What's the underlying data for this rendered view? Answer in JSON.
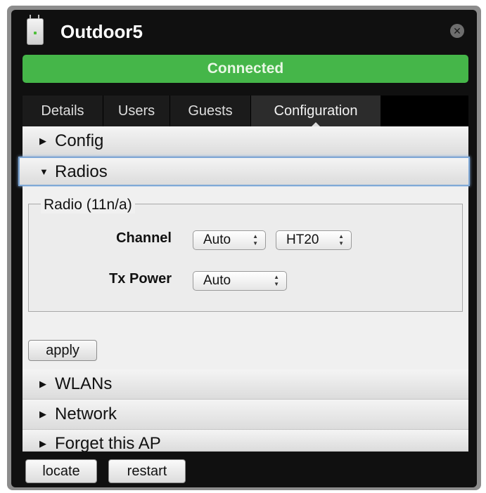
{
  "window": {
    "title": "Outdoor5",
    "close_icon": "close-icon",
    "device_icon": "access-point-icon"
  },
  "status": {
    "text": "Connected",
    "color": "#45b649"
  },
  "tabs": [
    {
      "label": "Details"
    },
    {
      "label": "Users"
    },
    {
      "label": "Guests"
    },
    {
      "label": "Configuration",
      "active": true
    }
  ],
  "sections": {
    "config": {
      "label": "Config",
      "expanded": false
    },
    "radios": {
      "label": "Radios",
      "expanded": true,
      "radio_group": {
        "legend": "Radio (11n/a)",
        "channel": {
          "label": "Channel",
          "value": "Auto",
          "width_value": "HT20"
        },
        "tx_power": {
          "label": "Tx Power",
          "value": "Auto"
        }
      },
      "apply_label": "apply"
    },
    "wlans": {
      "label": "WLANs",
      "expanded": false
    },
    "network": {
      "label": "Network",
      "expanded": false
    },
    "forget": {
      "label": "Forget this AP",
      "expanded": false
    }
  },
  "footer": {
    "locate_label": "locate",
    "restart_label": "restart"
  }
}
